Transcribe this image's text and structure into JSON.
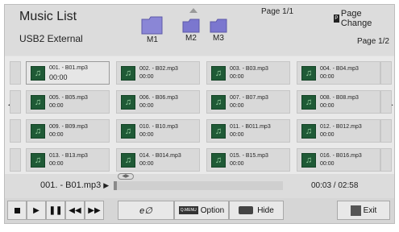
{
  "header": {
    "title": "Music List",
    "device": "USB2 External",
    "page_top": "Page 1/1",
    "page_change_key": "P",
    "page_change_label": "Page Change",
    "page_list": "Page 1/2"
  },
  "folders": [
    {
      "label": "M1"
    },
    {
      "label": "M2"
    },
    {
      "label": "M3"
    }
  ],
  "files": [
    {
      "name": "001. - B01.mp3",
      "time": "00:00"
    },
    {
      "name": "002. - B02.mp3",
      "time": "00:00"
    },
    {
      "name": "003. - B03.mp3",
      "time": "00:00"
    },
    {
      "name": "004. - B04.mp3",
      "time": "00:00"
    },
    {
      "name": "005. - B05.mp3",
      "time": "00:00"
    },
    {
      "name": "006. - B06.mp3",
      "time": "00:00"
    },
    {
      "name": "007. - B07.mp3",
      "time": "00:00"
    },
    {
      "name": "008. - B08.mp3",
      "time": "00:00"
    },
    {
      "name": "009. - B09.mp3",
      "time": "00:00"
    },
    {
      "name": "010. - B10.mp3",
      "time": "00:00"
    },
    {
      "name": "011. - B011.mp3",
      "time": "00:00"
    },
    {
      "name": "012. - B012.mp3",
      "time": "00:00"
    },
    {
      "name": "013. - B13.mp3",
      "time": "00:00"
    },
    {
      "name": "014. - B014.mp3",
      "time": "00:00"
    },
    {
      "name": "015. - B15.mp3",
      "time": "00:00"
    },
    {
      "name": "016. - B016.mp3",
      "time": "00:00"
    }
  ],
  "playback": {
    "now_playing": "001. - B01.mp3",
    "time": "00:03 / 02:58",
    "progress_fraction": 0.017
  },
  "controls": {
    "option_key": "Q.MENU",
    "option_label": "Option",
    "hide_label": "Hide",
    "exit_label": "Exit"
  },
  "colors": {
    "background": "#e2e2e2",
    "folder": "#8a86d6",
    "file_icon": "#1f5a36"
  }
}
